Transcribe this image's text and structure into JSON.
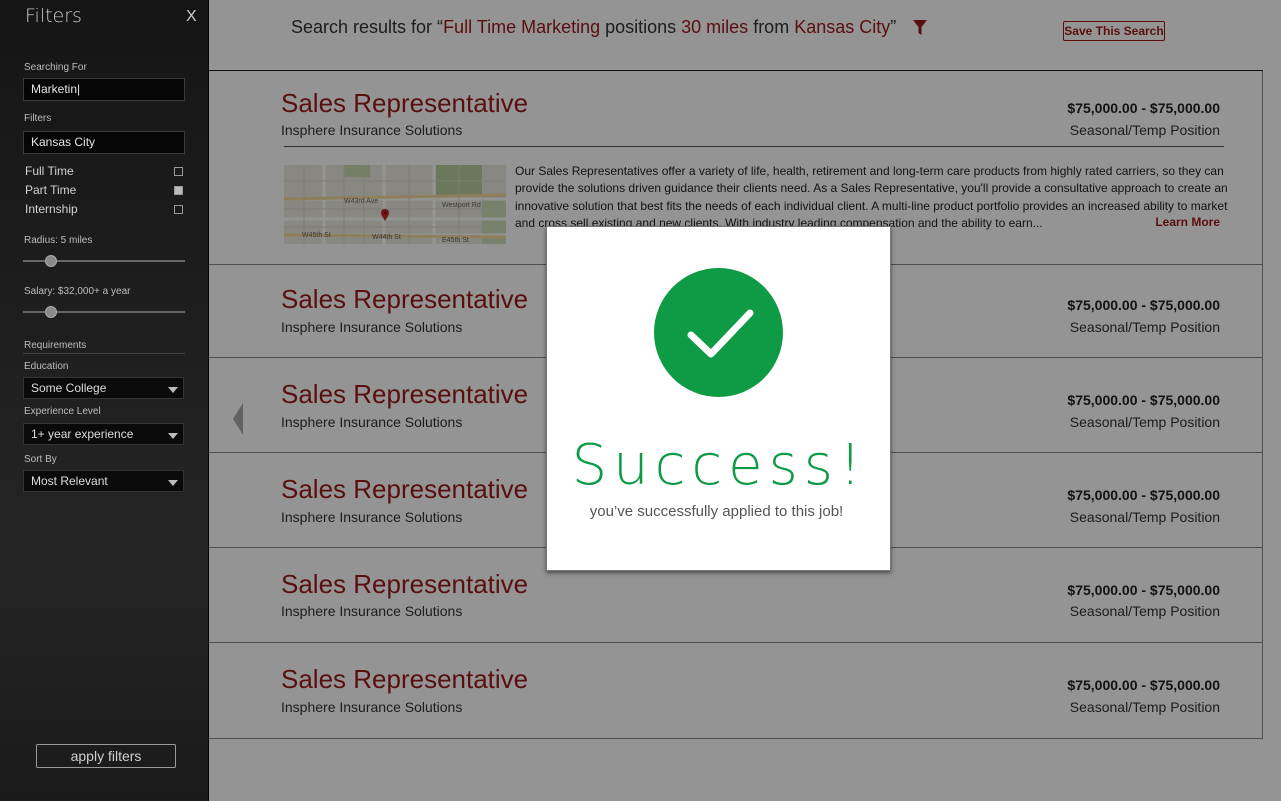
{
  "sidebar": {
    "title": "Filters",
    "close": "X",
    "searching_for_label": "Searching For",
    "searching_for_value": "Marketin|",
    "filters_label": "Filters",
    "location_value": "Kansas City",
    "job_types": [
      {
        "label": "Full Time",
        "checked": false
      },
      {
        "label": "Part Time",
        "checked": true
      },
      {
        "label": "Internship",
        "checked": false
      }
    ],
    "radius_label": "Radius: 5 miles",
    "radius_level": 0.17,
    "salary_label": "Salary: $32,000+ a year",
    "salary_level": 0.17,
    "requirements_label": "Requirements",
    "education_label": "Education",
    "education_value": "Some College",
    "experience_label": "Experience Level",
    "experience_value": "1+ year experience",
    "sort_label": "Sort By",
    "sort_value": "Most Relevant",
    "apply_label": "apply filters"
  },
  "header": {
    "prefix": "Search results for “",
    "keyword": "Full Time Marketing",
    "mid1": " positions ",
    "distance": "30 miles",
    "mid2": " from ",
    "location": "Kansas City",
    "suffix": "”",
    "save_label": "Save This Search",
    "accent": "#9b1a1a"
  },
  "results": [
    {
      "title": "Sales Representative",
      "company": "Insphere Insurance Solutions",
      "salary": "$75,000.00 - $75,000.00",
      "type": "Seasonal/Temp Position",
      "description": "Our Sales Representatives offer a variety of life, health, retirement and long-term care products from highly rated carriers, so they can provide the solutions driven guidance their clients need. As a Sales Representative, you'll provide a consultative approach to create an innovative solution that best fits the needs of each individual client. A multi-line product portfolio provides an increased ability to market and cross sell existing and new clients. With industry leading compensation and the ability to earn...",
      "learn_more": "Learn More"
    },
    {
      "title": "Sales Representative",
      "company": "Insphere Insurance Solutions",
      "salary": "$75,000.00 - $75,000.00",
      "type": "Seasonal/Temp Position"
    },
    {
      "title": "Sales Representative",
      "company": "Insphere Insurance Solutions",
      "salary": "$75,000.00 - $75,000.00",
      "type": "Seasonal/Temp Position"
    },
    {
      "title": "Sales Representative",
      "company": "Insphere Insurance Solutions",
      "salary": "$75,000.00 - $75,000.00",
      "type": "Seasonal/Temp Position"
    },
    {
      "title": "Sales Representative",
      "company": "Insphere Insurance Solutions",
      "salary": "$75,000.00 - $75,000.00",
      "type": "Seasonal/Temp Position"
    },
    {
      "title": "Sales Representative",
      "company": "Insphere Insurance Solutions",
      "salary": "$75,000.00 - $75,000.00",
      "type": "Seasonal/Temp Position"
    }
  ],
  "map_labels": [
    "W43rd Ave",
    "W44th St",
    "Westport Rd",
    "W45th St",
    "E45th St"
  ],
  "modal": {
    "title": "Success!",
    "subtitle": "you’ve successfully applied to this job!",
    "success_color": "#0f9a46"
  }
}
